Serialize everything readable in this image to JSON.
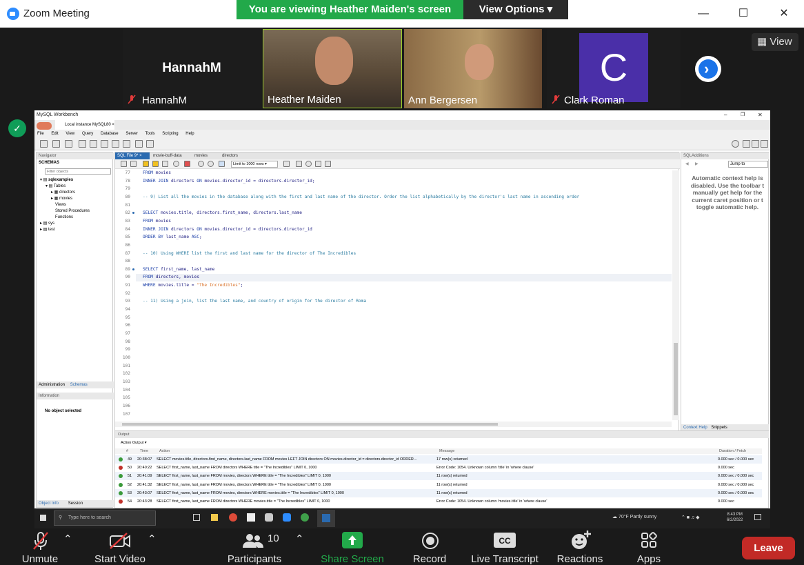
{
  "zoom": {
    "window_title": "Zoom Meeting",
    "banner": "You are viewing Heather Maiden's screen",
    "view_options": "View Options",
    "view_label": "View",
    "participants": [
      {
        "name": "HannahM",
        "big_label": "HannahM",
        "muted": true
      },
      {
        "name": "Heather Maiden",
        "muted": false
      },
      {
        "name": "Ann Bergersen",
        "muted": false
      },
      {
        "name": "Clark Roman",
        "avatar_letter": "C",
        "muted": true
      }
    ],
    "toolbar": {
      "unmute": "Unmute",
      "start_video": "Start Video",
      "participants": "Participants",
      "participant_count": "10",
      "share_screen": "Share Screen",
      "record": "Record",
      "live_transcript": "Live Transcript",
      "reactions": "Reactions",
      "apps": "Apps",
      "leave": "Leave"
    },
    "colors": {
      "banner_green": "#22a94a",
      "leave_red": "#c22a26",
      "share_green": "#22a94a"
    }
  },
  "workbench": {
    "app_title": "MySQL Workbench",
    "connection_tab": "Local instance MySQL80",
    "menu": [
      "File",
      "Edit",
      "View",
      "Query",
      "Database",
      "Server",
      "Tools",
      "Scripting",
      "Help"
    ],
    "navigator": {
      "title": "Navigator",
      "schemas_label": "SCHEMAS",
      "filter_placeholder": "Filter objects",
      "tree": [
        "sqlexamples",
        "Tables",
        "directors",
        "movies",
        "Views",
        "Stored Procedures",
        "Functions",
        "sys",
        "test"
      ],
      "tabs": [
        "Administration",
        "Schemas"
      ],
      "info_title": "Information",
      "info_text": "No object selected",
      "bottom_tabs": [
        "Object Info",
        "Session"
      ]
    },
    "editor_tabs": [
      "SQL File 9*",
      "movie-buff-data",
      "movies",
      "directors"
    ],
    "limit_select": "Limit to 1000 rows",
    "code_lines": [
      {
        "n": "77",
        "text": "FROM movies"
      },
      {
        "n": "78",
        "text": "INNER JOIN directors ON movies.director_id = directors.director_id;"
      },
      {
        "n": "79",
        "text": ""
      },
      {
        "n": "80",
        "text": "-- 9) List all the movies in the database along with the first and last name of the director. Order the list alphabetically by the director's last name in ascending order"
      },
      {
        "n": "81",
        "text": ""
      },
      {
        "n": "82",
        "text": "SELECT movies.title, directors.first_name, directors.last_name"
      },
      {
        "n": "83",
        "text": "FROM movies"
      },
      {
        "n": "84",
        "text": "INNER JOIN directors ON movies.director_id = directors.director_id"
      },
      {
        "n": "85",
        "text": "ORDER BY last_name ASC;"
      },
      {
        "n": "86",
        "text": ""
      },
      {
        "n": "87",
        "text": "-- 10) Using WHERE list the first and last name for the director of The Incredibles"
      },
      {
        "n": "88",
        "text": ""
      },
      {
        "n": "89",
        "text": "SELECT first_name, last_name"
      },
      {
        "n": "90",
        "text": "FROM directors, movies"
      },
      {
        "n": "91",
        "text": "WHERE movies.title = \"The Incredibles\";"
      },
      {
        "n": "92",
        "text": ""
      },
      {
        "n": "93",
        "text": "-- 11) Using a join, list the last name, and country of origin for the director of Roma"
      },
      {
        "n": "94",
        "text": ""
      },
      {
        "n": "95",
        "text": ""
      },
      {
        "n": "96",
        "text": ""
      },
      {
        "n": "97",
        "text": ""
      },
      {
        "n": "98",
        "text": ""
      },
      {
        "n": "99",
        "text": ""
      },
      {
        "n": "100",
        "text": ""
      },
      {
        "n": "101",
        "text": ""
      },
      {
        "n": "102",
        "text": ""
      },
      {
        "n": "103",
        "text": ""
      },
      {
        "n": "104",
        "text": ""
      },
      {
        "n": "105",
        "text": ""
      },
      {
        "n": "106",
        "text": ""
      },
      {
        "n": "107",
        "text": ""
      }
    ],
    "sql_additions": {
      "title": "SQLAdditions",
      "jump_to": "Jump to",
      "help_text": "Automatic context help is disabled. Use the toolbar t manually get help for the current caret position or t toggle automatic help.",
      "tabs": [
        "Context Help",
        "Snippets"
      ]
    },
    "output": {
      "title": "Output",
      "select": "Action Output",
      "headers": [
        "#",
        "Time",
        "Action",
        "Message",
        "Duration / Fetch"
      ],
      "rows": [
        {
          "status": "ok",
          "num": "49",
          "time": "20:38:07",
          "action": "SELECT movies.title, directors.first_name, directors.last_name FROM movies LEFT JOIN directors ON movies.director_id = directors.director_id ORDER...",
          "message": "17 row(s) returned",
          "duration": "0.000 sec / 0.000 sec"
        },
        {
          "status": "err",
          "num": "50",
          "time": "20:40:22",
          "action": "SELECT first_name, last_name FROM directors WHERE title = \"The Incredibles\" LIMIT 0, 1000",
          "message": "Error Code: 1054. Unknown column 'title' in 'where clause'",
          "duration": "0.000 sec"
        },
        {
          "status": "ok",
          "num": "51",
          "time": "20:41:09",
          "action": "SELECT first_name, last_name FROM movies, directors WHERE title = \"The Incredibles\" LIMIT 0, 1000",
          "message": "11 row(s) returned",
          "duration": "0.000 sec / 0.000 sec"
        },
        {
          "status": "ok",
          "num": "52",
          "time": "20:41:32",
          "action": "SELECT first_name, last_name FROM movies, directors WHERE title = \"The Incredibles\" LIMIT 0, 1000",
          "message": "11 row(s) returned",
          "duration": "0.000 sec / 0.000 sec"
        },
        {
          "status": "ok",
          "num": "53",
          "time": "20:43:07",
          "action": "SELECT first_name, last_name FROM movies, directors WHERE movies.title = \"The Incredibles\" LIMIT 0, 1000",
          "message": "11 row(s) returned",
          "duration": "0.000 sec / 0.000 sec"
        },
        {
          "status": "err",
          "num": "54",
          "time": "20:43:28",
          "action": "SELECT first_name, last_name FROM directors WHERE movies.title = \"The Incredibles\" LIMIT 0, 1000",
          "message": "Error Code: 1054. Unknown column 'movies.title' in 'where clause'",
          "duration": "0.000 sec"
        }
      ]
    }
  },
  "taskbar": {
    "search_placeholder": "Type here to search",
    "weather": "70°F  Partly sunny",
    "time": "8:43 PM",
    "date": "6/2/2022"
  }
}
